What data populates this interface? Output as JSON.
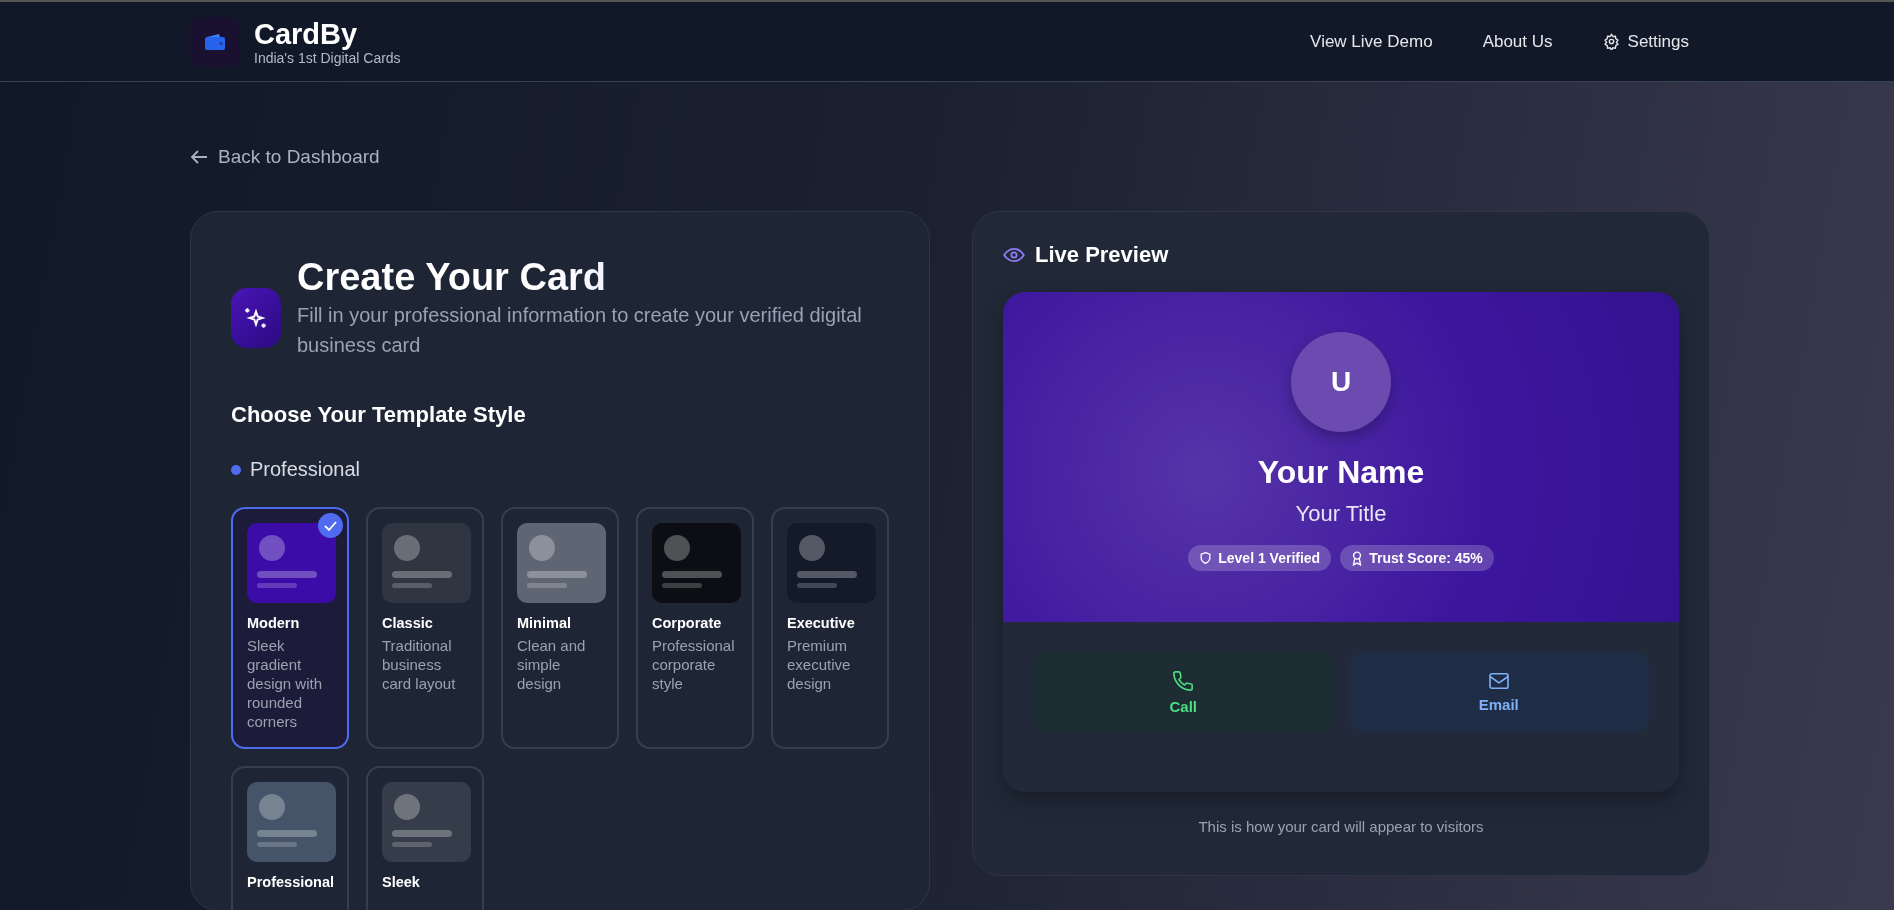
{
  "header": {
    "brand": "CardBy",
    "tagline": "India's 1st Digital Cards",
    "nav": [
      {
        "label": "View Live Demo",
        "kind": "link"
      },
      {
        "label": "About Us",
        "kind": "link"
      },
      {
        "label": "Settings",
        "kind": "settings"
      }
    ]
  },
  "back_link": "Back to Dashboard",
  "form": {
    "title": "Create Your Card",
    "subtitle": "Fill in your professional information to create your verified digital business card",
    "section_title": "Choose Your Template Style",
    "group": "Professional",
    "templates": [
      {
        "name": "Modern",
        "description": "Sleek gradient design with rounded corners",
        "color": "#3b0ca8",
        "selected": true
      },
      {
        "name": "Classic",
        "description": "Traditional business card layout",
        "color": "#2f3642",
        "selected": false
      },
      {
        "name": "Minimal",
        "description": "Clean and simple design",
        "color": "#5f6673",
        "selected": false
      },
      {
        "name": "Corporate",
        "description": "Professional corporate style",
        "color": "#0c0e13",
        "selected": false
      },
      {
        "name": "Executive",
        "description": "Premium executive design",
        "color": "#131a2a",
        "selected": false
      },
      {
        "name": "Professional",
        "color": "#455468",
        "selected": false
      },
      {
        "name": "Sleek",
        "color": "#363d4a",
        "selected": false
      }
    ]
  },
  "preview": {
    "title": "Live Preview",
    "avatar": "U",
    "name": "Your Name",
    "job_title": "Your Title",
    "badges": [
      {
        "label": "Level 1 Verified",
        "kind": "shield"
      },
      {
        "label": "Trust Score: 45%",
        "kind": "award"
      }
    ],
    "actions": [
      {
        "label": "Call",
        "kind": "call"
      },
      {
        "label": "Email",
        "kind": "email"
      }
    ],
    "note": "This is how your card will appear to visitors"
  }
}
